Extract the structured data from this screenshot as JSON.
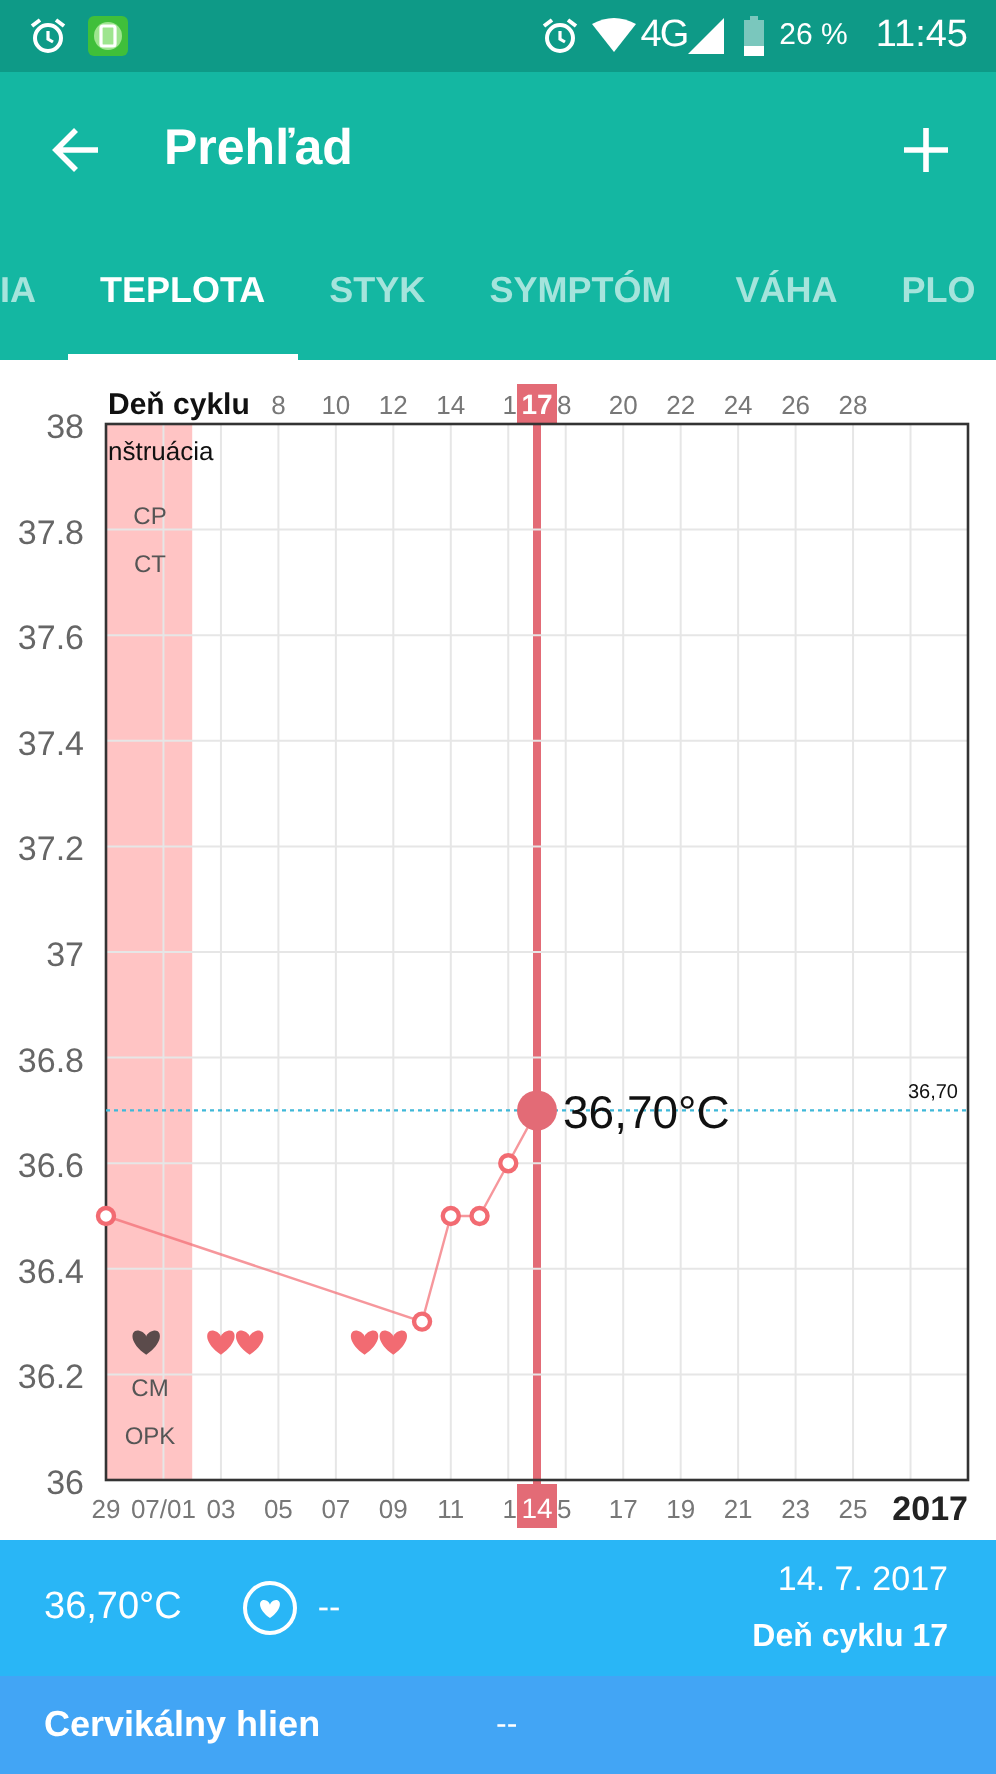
{
  "status_bar": {
    "network": "4G",
    "battery_text": "26 %",
    "time": "11:45"
  },
  "app_bar": {
    "title": "Prehľad"
  },
  "tabs": [
    {
      "label": "IA",
      "selected": false
    },
    {
      "label": "TEPLOTA",
      "selected": true
    },
    {
      "label": "STYK",
      "selected": false
    },
    {
      "label": "SYMPTÓM",
      "selected": false
    },
    {
      "label": "VÁHA",
      "selected": false
    },
    {
      "label": "PLO",
      "selected": false
    }
  ],
  "chart": {
    "top_axis_title": "Deň cyklu",
    "top_ticks": [
      "8",
      "10",
      "12",
      "14",
      "1",
      "8",
      "20",
      "22",
      "24",
      "26",
      "28"
    ],
    "year_label": "2017",
    "band_label": "nštruácia",
    "hearts": [
      {
        "color": "#5b4b4b"
      },
      {
        "color": "#f26b72"
      },
      {
        "color": "#f26b72"
      },
      {
        "color": "#f26b72"
      },
      {
        "color": "#f26b72"
      }
    ],
    "row_labels_top": [
      "CP",
      "CT"
    ],
    "row_labels_bottom": [
      "CM",
      "OPK"
    ],
    "cursor": {
      "top_label": "17",
      "bottom_label": "14",
      "point_label": "36,70°C"
    },
    "chart_data": {
      "type": "line",
      "ylim": [
        36,
        38
      ],
      "grid": true,
      "ref_lines": [
        {
          "axis": "y",
          "value": 36.7,
          "label": "36,70"
        }
      ],
      "categories": [
        "29",
        null,
        "07/01",
        null,
        "03",
        null,
        "05",
        null,
        "07",
        null,
        "09",
        null,
        "11",
        null,
        "1",
        null,
        "5",
        null,
        "17",
        null,
        "19",
        null,
        "21",
        null,
        "23",
        null,
        "25",
        null,
        null,
        null,
        null
      ],
      "yticks": [
        36,
        36.2,
        36.4,
        36.6,
        36.8,
        37,
        37.2,
        37.4,
        37.6,
        37.8,
        38
      ],
      "series": [
        {
          "color": "#f26b72",
          "marker": "o",
          "values": [
            36.5,
            null,
            null,
            null,
            null,
            null,
            null,
            null,
            null,
            null,
            null,
            36.3,
            36.5,
            36.5,
            36.6,
            36.7,
            null,
            null,
            null,
            null,
            null,
            null,
            null,
            null,
            null,
            null,
            null,
            null,
            null,
            null,
            null
          ]
        }
      ]
    }
  },
  "summary": {
    "temperature": "36,70°C",
    "sex_value": "--",
    "date": "14. 7. 2017",
    "cycle_day": "Deň cyklu 17"
  },
  "details": [
    {
      "label": "Cervikálny hlien",
      "value": "--"
    }
  ]
}
